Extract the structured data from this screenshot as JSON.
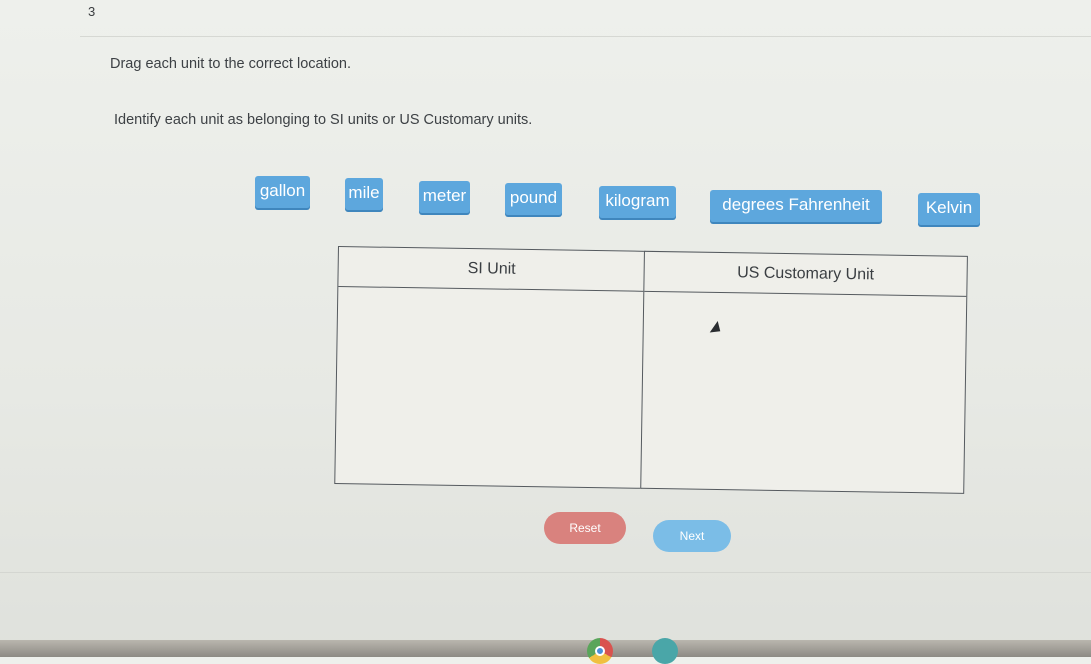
{
  "question_number": "3",
  "instructions": {
    "line1": "Drag each unit to the correct location.",
    "line2": "Identify each unit as belonging to SI units or US Customary units."
  },
  "units": [
    {
      "label": "gallon"
    },
    {
      "label": "mile"
    },
    {
      "label": "meter"
    },
    {
      "label": "pound"
    },
    {
      "label": "kilogram"
    },
    {
      "label": "degrees Fahrenheit"
    },
    {
      "label": "Kelvin"
    }
  ],
  "table": {
    "si_header": "SI Unit",
    "us_header": "US Customary Unit"
  },
  "buttons": {
    "reset": "Reset",
    "next": "Next"
  },
  "colors": {
    "chip": "#5da7dd",
    "reset": "#d9827e",
    "next": "#7bbde7"
  },
  "icons": [
    "chrome-icon",
    "files-icon"
  ]
}
